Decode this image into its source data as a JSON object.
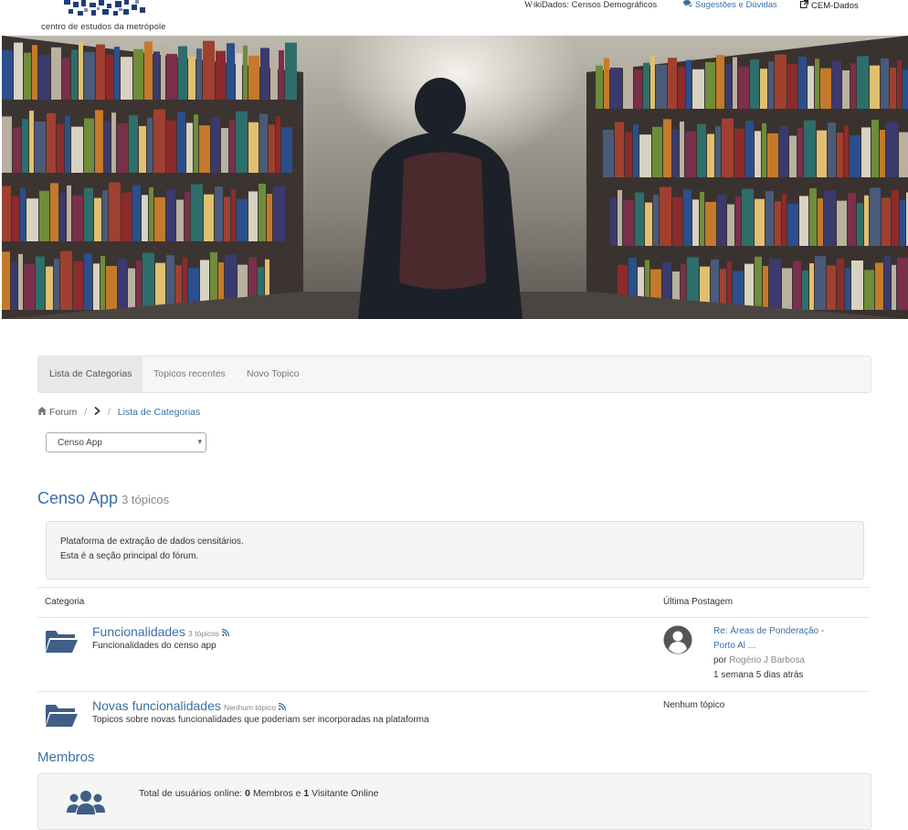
{
  "header": {
    "logo_text": "centro de estudos da metrópole",
    "nav": [
      {
        "label": "ikiDados: Censos Demográficos",
        "icon": "wikipedia-w-icon",
        "glyph": "W"
      },
      {
        "label": "Sugestões e Dúvidas",
        "icon": "comments-icon"
      },
      {
        "label": "CEM-Dados",
        "icon": "external-link-icon"
      }
    ]
  },
  "tabs": [
    {
      "label": "Lista de Categorias",
      "active": true
    },
    {
      "label": "Topicos recentes",
      "active": false
    },
    {
      "label": "Novo Topico",
      "active": false
    }
  ],
  "breadcrumb": {
    "home": "Forum",
    "separator": "/",
    "current": "Lista de Categorias"
  },
  "category_select": {
    "value": "Censo App",
    "arrow": "▾"
  },
  "category": {
    "title": "Censo App",
    "count": "3 tópicos",
    "description_lines": [
      "Plataforma de extração de dados censitários.",
      "Esta é a seção principal do fórum."
    ]
  },
  "table": {
    "headers": {
      "category": "Categoria",
      "last_post": "Última Postagem"
    },
    "rows": [
      {
        "name": "Funcionalidades",
        "count": "3 tópicos",
        "description": "Funcionalidades do censo app",
        "last_post_title_1": "Re: Áreas de Ponderação -",
        "last_post_title_2": "Porto Al ...",
        "by": "por",
        "author": "Rogério J Barbosa",
        "time": "1 semana 5 dias atrás"
      },
      {
        "name": "Novas funcionalidades",
        "count": "Nenhum tópico",
        "description": "Topicos sobre novas funcionalidades que poderiam ser incorporadas na plataforma",
        "no_topic": "Nenhum tópico"
      }
    ]
  },
  "members": {
    "title": "Membros",
    "online_prefix": "Total de usuários online:",
    "members_count": "0",
    "members_label": "Membros e",
    "visitors_count": "1",
    "visitors_label": "Visitante Online"
  },
  "colors": {
    "link": "#3a6fa5",
    "folder_icon": "#3f5f86",
    "avatar": "#555555"
  }
}
